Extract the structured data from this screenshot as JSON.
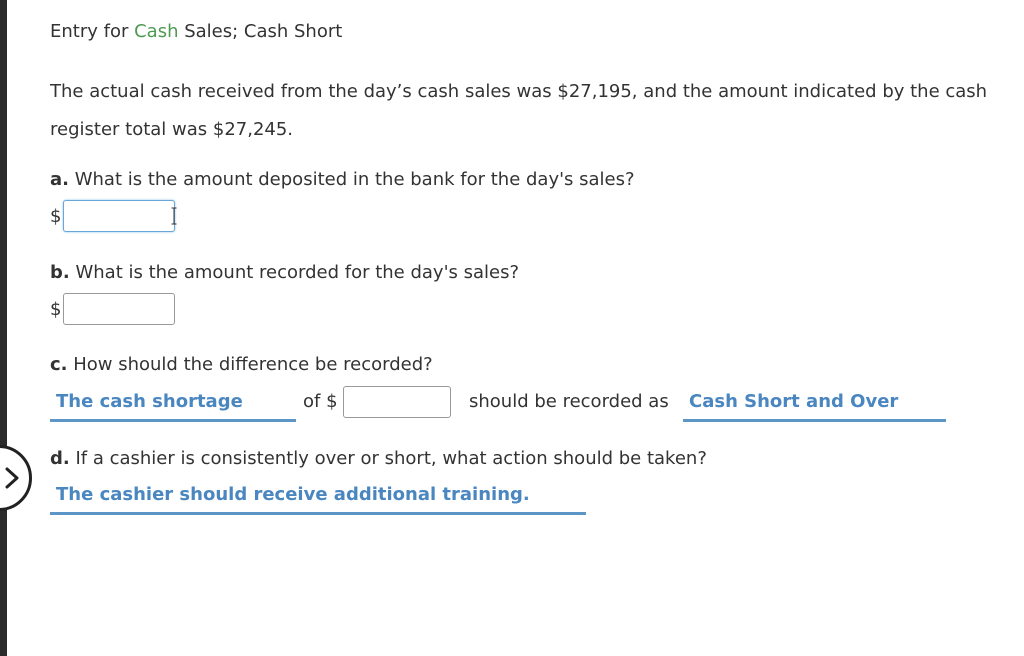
{
  "title": {
    "prefix": "Entry for ",
    "link": "Cash",
    "suffix": " Sales; Cash Short"
  },
  "problem_text": "The actual cash received from the day’s cash sales was $27,195, and the amount indicated by the cash register total was $27,245.",
  "questions": {
    "a": {
      "letter": "a.",
      "text": " What is the amount deposited in the bank for the day's sales?",
      "currency": "$",
      "value": ""
    },
    "b": {
      "letter": "b.",
      "text": " What is the amount recorded for the day's sales?",
      "currency": "$",
      "value": ""
    },
    "c": {
      "letter": "c.",
      "text": " How should the difference be recorded?",
      "shortage_selection": "The cash shortage",
      "of_label": "of $",
      "value": "",
      "recorded_as_label": "should be recorded as",
      "account_selection": "Cash Short and Over"
    },
    "d": {
      "letter": "d.",
      "text": " If a cashier is consistently over or short, what action should be taken?",
      "action_selection": "The cashier should receive additional training."
    }
  },
  "colors": {
    "link_green": "#4e9a52",
    "dropdown_blue": "#4a86bf",
    "underline_blue": "#5b96c6"
  }
}
